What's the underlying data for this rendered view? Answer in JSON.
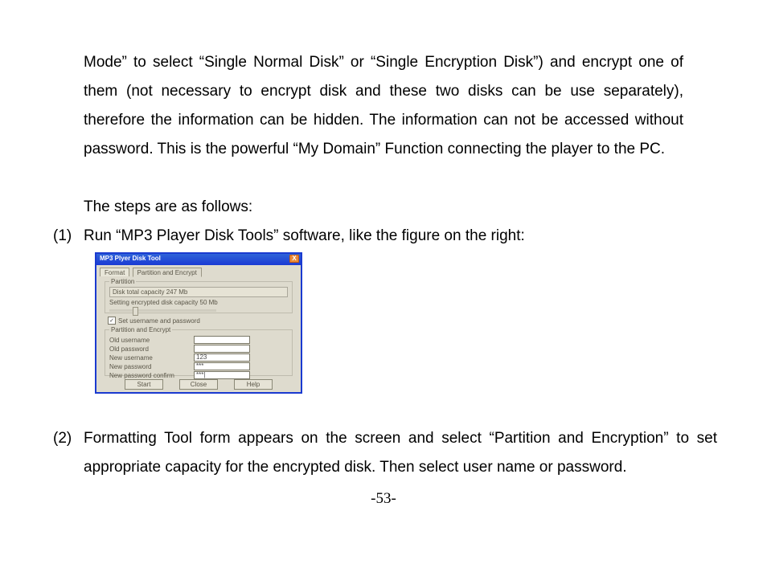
{
  "paragraphs": {
    "p1": "Mode” to select “Single Normal Disk” or “Single Encryption Disk”) and encrypt one of them (not necessary to encrypt disk and these two disks can be use separately), therefore the information can be hidden. The information can not be accessed without password. This is the powerful “My Domain” Function connecting the player to the PC.",
    "p2": "The steps are as follows:"
  },
  "list": {
    "item1": {
      "num": "(1)",
      "text": "Run “MP3 Player Disk Tools” software, like the figure on the right:"
    },
    "item2": {
      "num": "(2)",
      "text": "Formatting Tool form appears on the screen and select “Partition and Encryption” to set appropriate capacity for the encrypted disk. Then select user name or password."
    }
  },
  "page_number": "-53-",
  "dialog": {
    "title": "MP3 Plyer Disk Tool",
    "tab_format": "Format",
    "tab_pe": "Partition and Encrypt",
    "partition_legend": "Partition",
    "disk_total": "Disk total capacity 247 Mb",
    "setting_enc": "Setting encrypted disk capacity 50 Mb",
    "chk_label": "Set username and password",
    "pe_legend": "Partition and Encrypt",
    "lbl_old_user": "Old username",
    "lbl_old_pass": "Old password",
    "lbl_new_user": "New username",
    "lbl_new_pass": "New password",
    "lbl_new_pass_c": "New password confirm",
    "val_new_user": "123",
    "val_new_pass": "***",
    "val_new_pass_c": "***|",
    "btn_start": "Start",
    "btn_close": "Close",
    "btn_help": "Help",
    "close_x": "X"
  }
}
